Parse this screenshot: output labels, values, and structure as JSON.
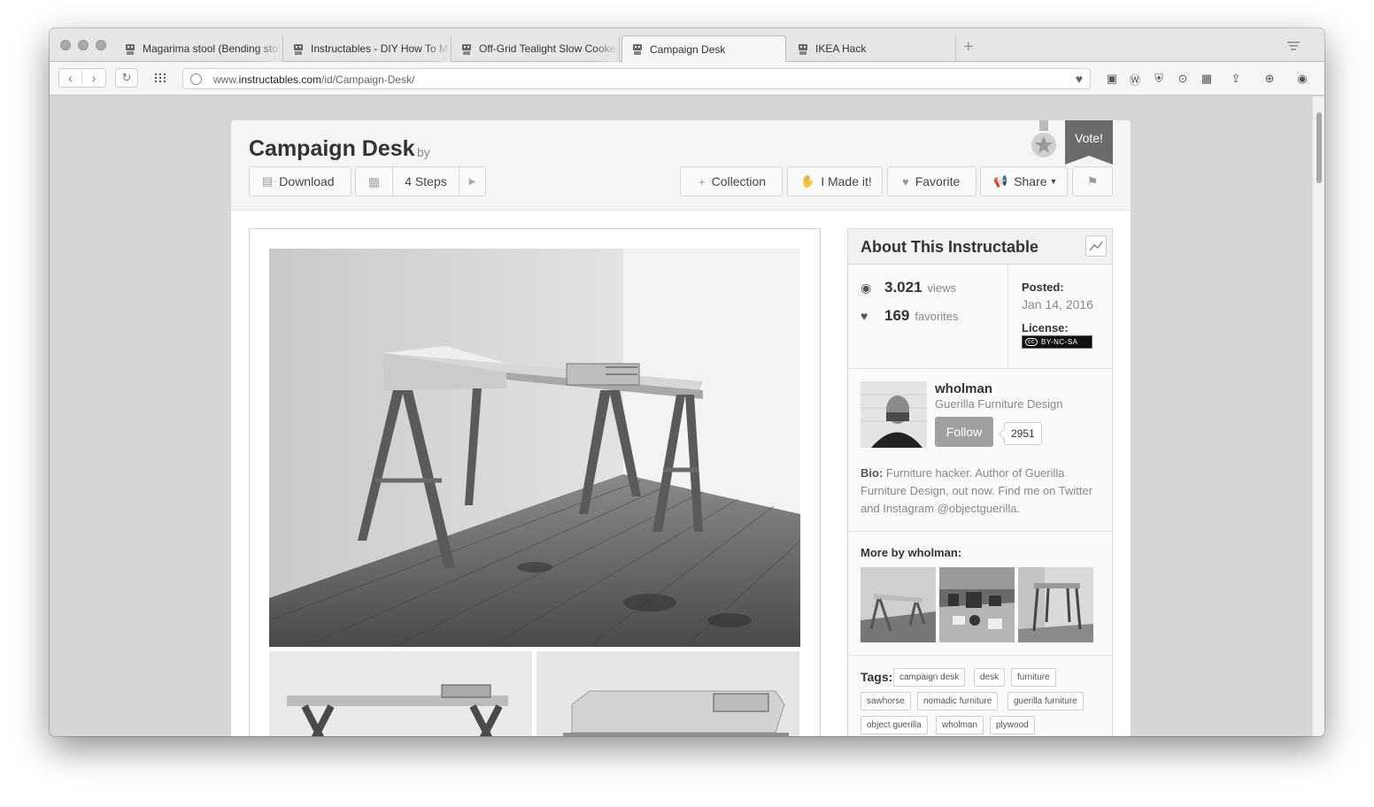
{
  "browser": {
    "tabs": [
      {
        "label": "Magarima stool (Bending sto"
      },
      {
        "label": "Instructables - DIY How To M"
      },
      {
        "label": "Off-Grid Tealight Slow Cooke"
      },
      {
        "label": "Campaign Desk"
      },
      {
        "label": "IKEA Hack"
      }
    ],
    "new_tab": "+",
    "url_prefix": "www.",
    "url_domain": "instructables.com",
    "url_path": "/id/Campaign-Desk/"
  },
  "header": {
    "title": "Campaign Desk",
    "by": "by",
    "author": "wholman",
    "vote": "Vote!",
    "buttons": {
      "download": "Download",
      "steps": "4 Steps",
      "collection": "Collection",
      "made_it": "I Made it!",
      "favorite": "Favorite",
      "share": "Share"
    }
  },
  "about": {
    "heading": "About This Instructable",
    "views_count": "3.021",
    "views_unit": "views",
    "favorites_count": "169",
    "favorites_unit": "favorites",
    "posted_label": "Posted:",
    "posted_date": "Jan 14, 2016",
    "license_label": "License:",
    "license_badge": "BY-NC-SA",
    "license_cc": "cc"
  },
  "author_card": {
    "name": "wholman",
    "org": "Guerilla Furniture Design",
    "follow": "Follow",
    "followers": "2951",
    "bio_label": "Bio:",
    "bio_text": "Furniture hacker. Author of Guerilla Furniture Design, out now. Find me on Twitter and Instagram @objectguerilla."
  },
  "more": {
    "heading": "More by wholman:"
  },
  "tags": {
    "heading": "Tags:",
    "items": [
      "campaign desk",
      "desk",
      "furniture",
      "sawhorse",
      "nomadic furniture",
      "guerilla furniture",
      "object guerilla",
      "wholman",
      "plywood"
    ]
  }
}
